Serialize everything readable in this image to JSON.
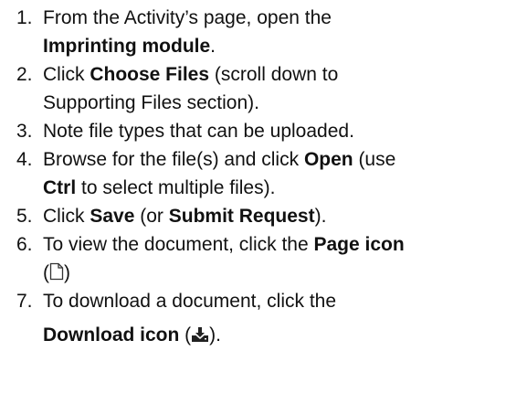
{
  "steps": [
    {
      "number": "1.",
      "l1": "From the Activity’s page, open the",
      "l2_bold": "Imprinting module",
      "l2_after": "."
    },
    {
      "number": "2.",
      "pre": "Click ",
      "bold": "Choose Files",
      "after_l1": " (scroll down to",
      "l2": "Supporting Files section)."
    },
    {
      "number": "3.",
      "text": "Note file types that can be uploaded."
    },
    {
      "number": "4.",
      "pre": "Browse for the file(s) and click ",
      "bold1": "Open",
      "mid": " (use",
      "l2_bold": "Ctrl",
      "l2_after": " to select multiple files)."
    },
    {
      "number": "5.",
      "pre": "Click ",
      "bold1": "Save",
      "mid": " (or ",
      "bold2": "Submit Request",
      "after": ")."
    },
    {
      "number": "6.",
      "pre": "To view the document, click the ",
      "bold": "Page icon",
      "l2_open": "(",
      "icon": "page-icon",
      "l2_close": ")"
    },
    {
      "number": "7.",
      "pre": "To download a document, click the",
      "l2_bold": "Download icon",
      "l2_open": " (",
      "icon": "download-icon",
      "l2_close": ")."
    }
  ]
}
